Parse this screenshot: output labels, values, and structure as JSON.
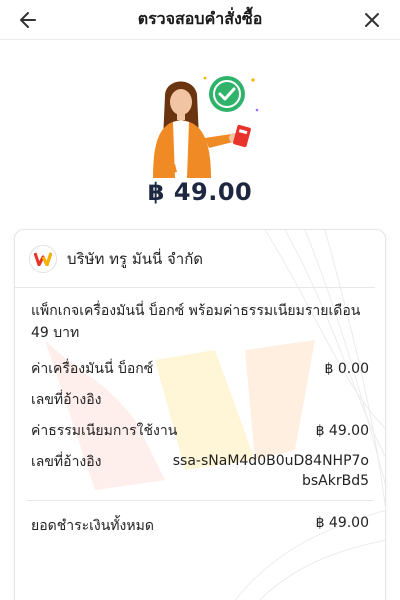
{
  "header": {
    "title": "ตรวจสอบคำสั่งซื้อ"
  },
  "hero": {
    "amount": "฿ 49.00"
  },
  "merchant": {
    "name": "บริษัท ทรู มันนี่ จำกัด"
  },
  "order": {
    "description": "แพ็กเกจเครื่องมันนี่ บ็อกซ์ พร้อมค่าธรรมเนียมรายเดือน 49 บาท",
    "rows": [
      {
        "label": "ค่าเครื่องมันนี่ บ็อกซ์",
        "value": "฿ 0.00"
      },
      {
        "label": "เลขที่อ้างอิง",
        "value": ""
      },
      {
        "label": "ค่าธรรมเนียมการใช้งาน",
        "value": "฿ 49.00"
      },
      {
        "label": "เลขที่อ้างอิง",
        "value": "ssa-sNaM4d0B0uD84NHP7obsAkrBd5"
      }
    ],
    "total_label": "ยอดชำระเงินทั้งหมด",
    "total_value": "฿ 49.00"
  },
  "colors": {
    "primary_text": "#1d2740",
    "success": "#2fb36a",
    "accent_orange": "#f08a24",
    "logo_red": "#e8332a",
    "logo_yellow": "#f5b300"
  },
  "icons": {
    "back": "arrow-left-icon",
    "close": "close-icon",
    "check": "check-circle-icon"
  }
}
